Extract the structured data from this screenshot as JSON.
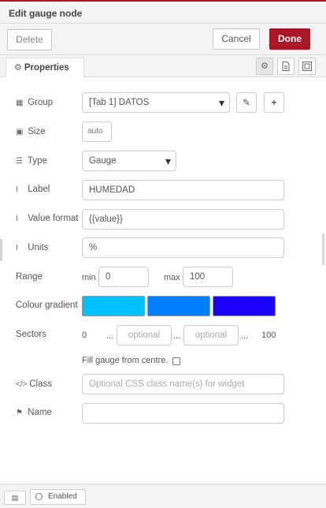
{
  "dialog": {
    "title": "Edit gauge node",
    "delete_label": "Delete",
    "cancel_label": "Cancel",
    "done_label": "Done",
    "accent_color": "#ad1625"
  },
  "tabs": {
    "properties_label": "Properties",
    "icons": [
      "gear-icon",
      "description-icon",
      "appearance-icon"
    ]
  },
  "form": {
    "group": {
      "label": "Group",
      "value": "[Tab 1] DATOS"
    },
    "size": {
      "label": "Size",
      "value": "auto"
    },
    "type": {
      "label": "Type",
      "value": "Gauge"
    },
    "label_field": {
      "label": "Label",
      "value": "HUMEDAD"
    },
    "value_format": {
      "label": "Value format",
      "value": "{{value}}"
    },
    "units": {
      "label": "Units",
      "value": "%"
    },
    "range": {
      "label": "Range",
      "min_label": "min",
      "min_value": "0",
      "max_label": "max",
      "max_value": "100"
    },
    "colour_gradient": {
      "label": "Colour gradient",
      "colors": [
        "#00c0ff",
        "#0080ff",
        "#1b02ff"
      ]
    },
    "sectors": {
      "label": "Sectors",
      "start": "0",
      "dots": "...",
      "placeholder1": "optional",
      "placeholder2": "optional",
      "end": "100"
    },
    "fill_centre": {
      "label": "Fill gauge from centre.",
      "checked": false
    },
    "class_field": {
      "label": "Class",
      "placeholder": "Optional CSS class name(s) for widget"
    },
    "name": {
      "label": "Name",
      "value": ""
    }
  },
  "footer": {
    "enabled_label": "Enabled"
  }
}
